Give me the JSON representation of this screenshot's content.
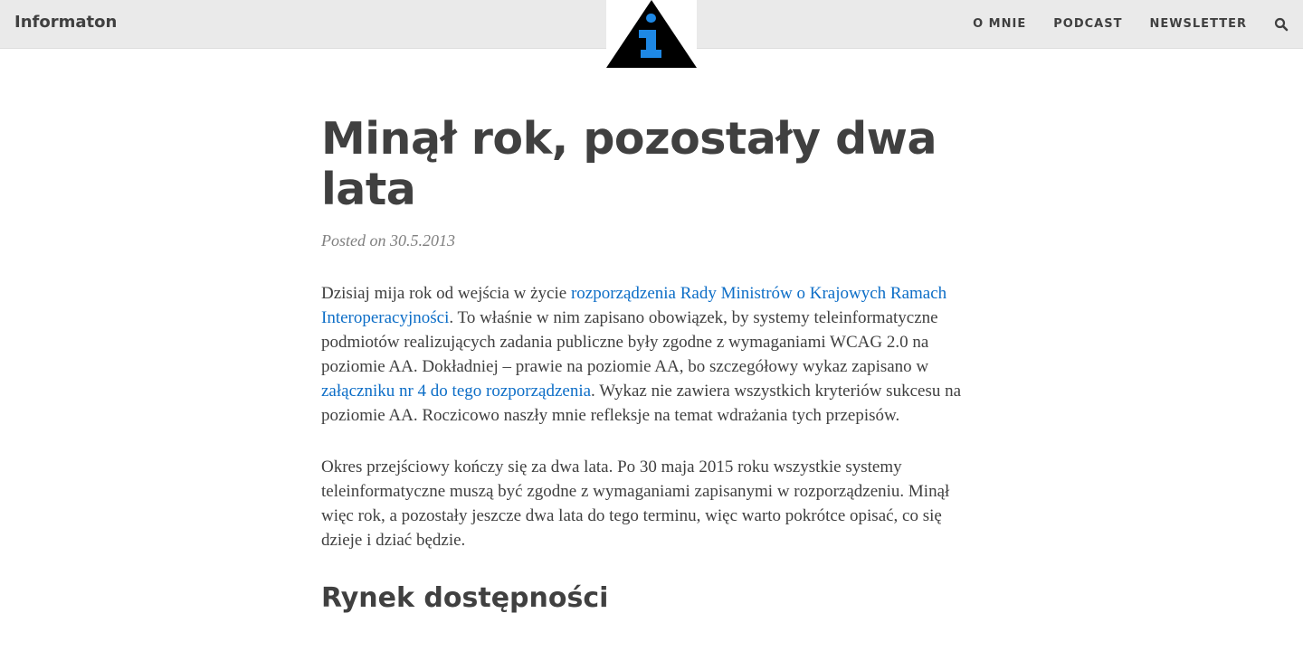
{
  "header": {
    "brand": "Informaton",
    "nav": [
      {
        "label": "O MNIE"
      },
      {
        "label": "PODCAST"
      },
      {
        "label": "NEWSLETTER"
      }
    ],
    "search_icon": "search-icon",
    "logo_icon": "info-triangle-icon"
  },
  "article": {
    "title": "Minął rok, pozostały dwa lata",
    "posted_prefix": "Posted on",
    "date": "30.5.2013",
    "p1": {
      "t1": "Dzisiaj mija rok od wejścia w życie ",
      "link1": "rozporządzenia Rady Ministrów o Krajowych Ramach Interoperacyjności",
      "t2": ". To właśnie w nim zapisano obowiązek, by systemy teleinformatyczne podmiotów realizujących zadania publiczne były zgodne z wymaganiami WCAG 2.0 na poziomie AA. Dokładniej – prawie na poziomie AA, bo szczegółowy wykaz zapisano w ",
      "link2": "załączniku nr 4 do tego rozporządzenia",
      "t3": ". Wykaz nie zawiera wszystkich kryteriów sukcesu na poziomie AA. Roczicowo naszły mnie refleksje na temat wdrażania tych przepisów."
    },
    "p2": "Okres przejściowy kończy się za dwa lata. Po 30 maja 2015 roku wszystkie systemy teleinformatyczne muszą być zgodne z wymaganiami zapisanymi w rozporządzeniu. Minął więc rok, a pozostały jeszcze dwa lata do tego terminu, więc warto pokrótce opisać, co się dzieje i dziać będzie.",
    "h2": "Rynek dostępności"
  },
  "colors": {
    "topbar": "#eaeaea",
    "text": "#404040",
    "link": "#0d6ec7",
    "logo_blue": "#1e88e5"
  }
}
